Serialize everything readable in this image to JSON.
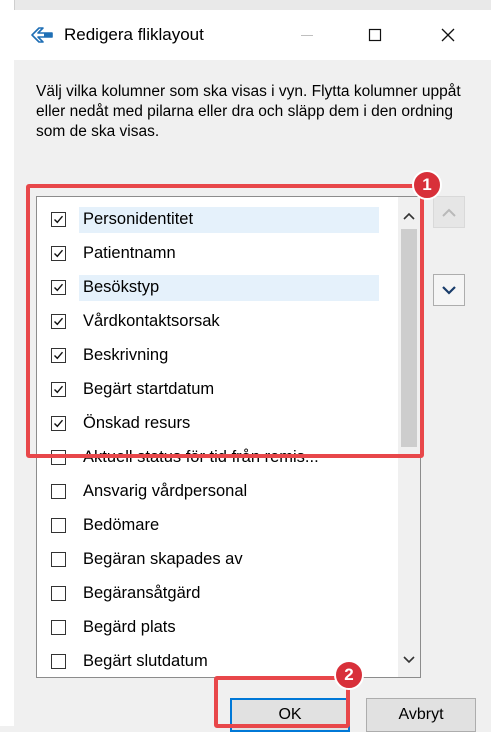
{
  "dialog": {
    "title": "Redigera fliklayout",
    "description": "Välj vilka kolumner som ska visas i vyn. Flytta kolumner uppåt eller nedåt med pilarna eller dra och släpp dem i den ordning som de ska visas."
  },
  "columns": [
    {
      "label": "Personidentitet",
      "checked": true,
      "highlighted": true
    },
    {
      "label": "Patientnamn",
      "checked": true,
      "highlighted": false
    },
    {
      "label": "Besökstyp",
      "checked": true,
      "highlighted": true
    },
    {
      "label": "Vårdkontaktsorsak",
      "checked": true,
      "highlighted": false
    },
    {
      "label": "Beskrivning",
      "checked": true,
      "highlighted": false
    },
    {
      "label": "Begärt startdatum",
      "checked": true,
      "highlighted": false
    },
    {
      "label": "Önskad resurs",
      "checked": true,
      "highlighted": false
    },
    {
      "label": "Aktuell status för tid från remis...",
      "checked": false,
      "highlighted": false
    },
    {
      "label": "Ansvarig vårdpersonal",
      "checked": false,
      "highlighted": false
    },
    {
      "label": "Bedömare",
      "checked": false,
      "highlighted": false
    },
    {
      "label": "Begäran skapades av",
      "checked": false,
      "highlighted": false
    },
    {
      "label": "Begäransåtgärd",
      "checked": false,
      "highlighted": false
    },
    {
      "label": "Begärd plats",
      "checked": false,
      "highlighted": false
    },
    {
      "label": "Begärt slutdatum",
      "checked": false,
      "highlighted": false
    }
  ],
  "buttons": {
    "ok": "OK",
    "cancel": "Avbryt"
  },
  "callouts": {
    "first": "1",
    "second": "2"
  },
  "icons": {
    "title": "pencil-edit-icon",
    "minimize": "minimize-icon",
    "maximize": "maximize-icon",
    "close": "close-icon",
    "move_up": "chevron-up-icon",
    "move_down": "chevron-down-icon"
  },
  "colors": {
    "accent": "#0078d7",
    "callout_red": "#d8303a",
    "highlight_border": "#e8474a",
    "row_highlight": "#e5f1fb"
  }
}
